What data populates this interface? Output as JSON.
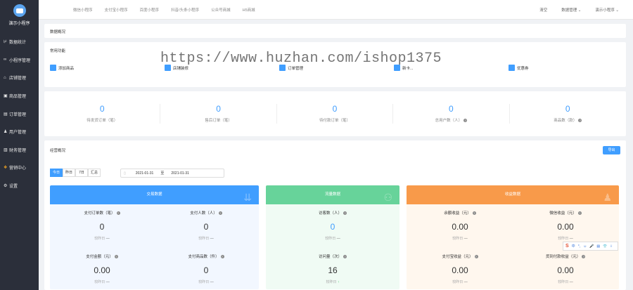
{
  "sidebar": {
    "app_name": "演示小程序",
    "items": [
      {
        "icon": "chart-icon",
        "glyph": "⊬",
        "label": "数据统计"
      },
      {
        "icon": "link-icon",
        "glyph": "∞",
        "label": "小程序管理"
      },
      {
        "icon": "store-icon",
        "glyph": "⌂",
        "label": "店铺管理"
      },
      {
        "icon": "product-icon",
        "glyph": "▣",
        "label": "商品管理"
      },
      {
        "icon": "order-icon",
        "glyph": "▤",
        "label": "订单管理"
      },
      {
        "icon": "user-icon",
        "glyph": "♟",
        "label": "用户管理"
      },
      {
        "icon": "finance-icon",
        "glyph": "▥",
        "label": "财务管理"
      },
      {
        "icon": "marketing-icon",
        "glyph": "❖",
        "label": "营销中心"
      },
      {
        "icon": "gear-icon",
        "glyph": "⚙",
        "label": "设置"
      }
    ]
  },
  "topnav": [
    "微信小程序",
    "支付宝小程序",
    "百度小程序",
    "抖音/头条小程序",
    "公众号商城",
    "H5商城"
  ],
  "topright": [
    "清空",
    "数据管理 ⌄",
    "演示小程序 ⌄"
  ],
  "overview": {
    "title": "数据概况"
  },
  "common": {
    "title": "常用功能",
    "items": [
      {
        "icon": "add-product-icon",
        "label": "添加商品"
      },
      {
        "icon": "store-decor-icon",
        "label": "店铺装修"
      },
      {
        "icon": "order-manage-icon",
        "label": "订单管理"
      },
      {
        "icon": "card-icon",
        "label": "新卡..."
      },
      {
        "icon": "coupon-icon",
        "label": "优惠券"
      }
    ]
  },
  "stats": [
    {
      "value": "0",
      "label": "待发货订单（笔）",
      "help": false
    },
    {
      "value": "0",
      "label": "售后订单（笔）",
      "help": false
    },
    {
      "value": "0",
      "label": "待付款订单（笔）",
      "help": false
    },
    {
      "value": "0",
      "label": "总用户数（人）",
      "help": true
    },
    {
      "value": "0",
      "label": "商品数（款）",
      "help": true
    }
  ],
  "operation": {
    "title": "经营概况",
    "export_label": "导出",
    "tabs": [
      "今日",
      "昨日",
      "7日",
      "汇总"
    ],
    "date_start": "2021-01-31",
    "date_sep": "至",
    "date_end": "2021-01-31",
    "cards": [
      {
        "title": "交易数据",
        "color": "#409eff",
        "bg": "#f2f7ff",
        "icon": "bag-icon",
        "glyph": "⇊",
        "cells": [
          {
            "title": "支付订单数（笔）",
            "value": "0",
            "compare": "较昨日",
            "trend": "—",
            "blue": false
          },
          {
            "title": "支付人数（人）",
            "value": "0",
            "compare": "较昨日",
            "trend": "—",
            "blue": false
          },
          {
            "title": "支付金额（元）",
            "value": "0.00",
            "compare": "较昨日",
            "trend": "—",
            "blue": false
          },
          {
            "title": "支付商品数（件）",
            "value": "0",
            "compare": "较昨日",
            "trend": "—",
            "blue": false
          }
        ]
      },
      {
        "title": "流量数据",
        "color": "#67d39a",
        "bg": "#f0fbf4",
        "icon": "users-icon",
        "glyph": "⚇",
        "cells": [
          {
            "title": "访客数（人）",
            "value": "0",
            "compare": "较昨日",
            "trend": "—",
            "blue": true
          },
          {
            "title": "访问量（次）",
            "value": "16",
            "compare": "较昨日",
            "trend": "↑",
            "blue": false
          }
        ]
      },
      {
        "title": "收益数据",
        "color": "#f89a4a",
        "bg": "#fff7ee",
        "icon": "person-icon",
        "glyph": "♟",
        "cells": [
          {
            "title": "余额收益（元）",
            "value": "0.00",
            "compare": "较昨日",
            "trend": "—",
            "blue": false
          },
          {
            "title": "微信收益（元）",
            "value": "0.00",
            "compare": "较昨日",
            "trend": "—",
            "blue": false
          },
          {
            "title": "支付宝收益（元）",
            "value": "0.00",
            "compare": "较昨日",
            "trend": "—",
            "blue": false
          },
          {
            "title": "货到付款收益（元）",
            "value": "0.00",
            "compare": "较昨日",
            "trend": "—",
            "blue": false
          }
        ]
      }
    ]
  },
  "watermark": "https://www.huzhan.com/ishop1375",
  "ime": {
    "logo": "S",
    "items": [
      "中",
      "°,",
      "☺",
      "🎤",
      "▤",
      "👕",
      "⁝⁝"
    ]
  }
}
